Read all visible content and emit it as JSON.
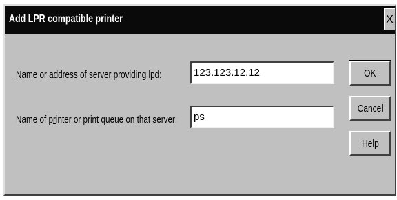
{
  "window": {
    "title": "Add LPR compatible printer",
    "close_glyph": "X",
    "close_icon": "close-icon"
  },
  "form": {
    "server_label_hotkey": "N",
    "server_label_rest": "ame or address of server providing lpd:",
    "server_value": "123.123.12.12",
    "queue_label_pre": "Name of p",
    "queue_label_hotkey": "r",
    "queue_label_post": "inter or print queue on that server:",
    "queue_value": "ps"
  },
  "buttons": {
    "ok_label": "OK",
    "cancel_label": "Cancel",
    "help_label_hotkey": "H",
    "help_label_rest": "elp"
  },
  "colors": {
    "titlebar": "#0a0a0a",
    "dialog_face": "#c0c0c0",
    "field_bg": "#ffffff"
  }
}
